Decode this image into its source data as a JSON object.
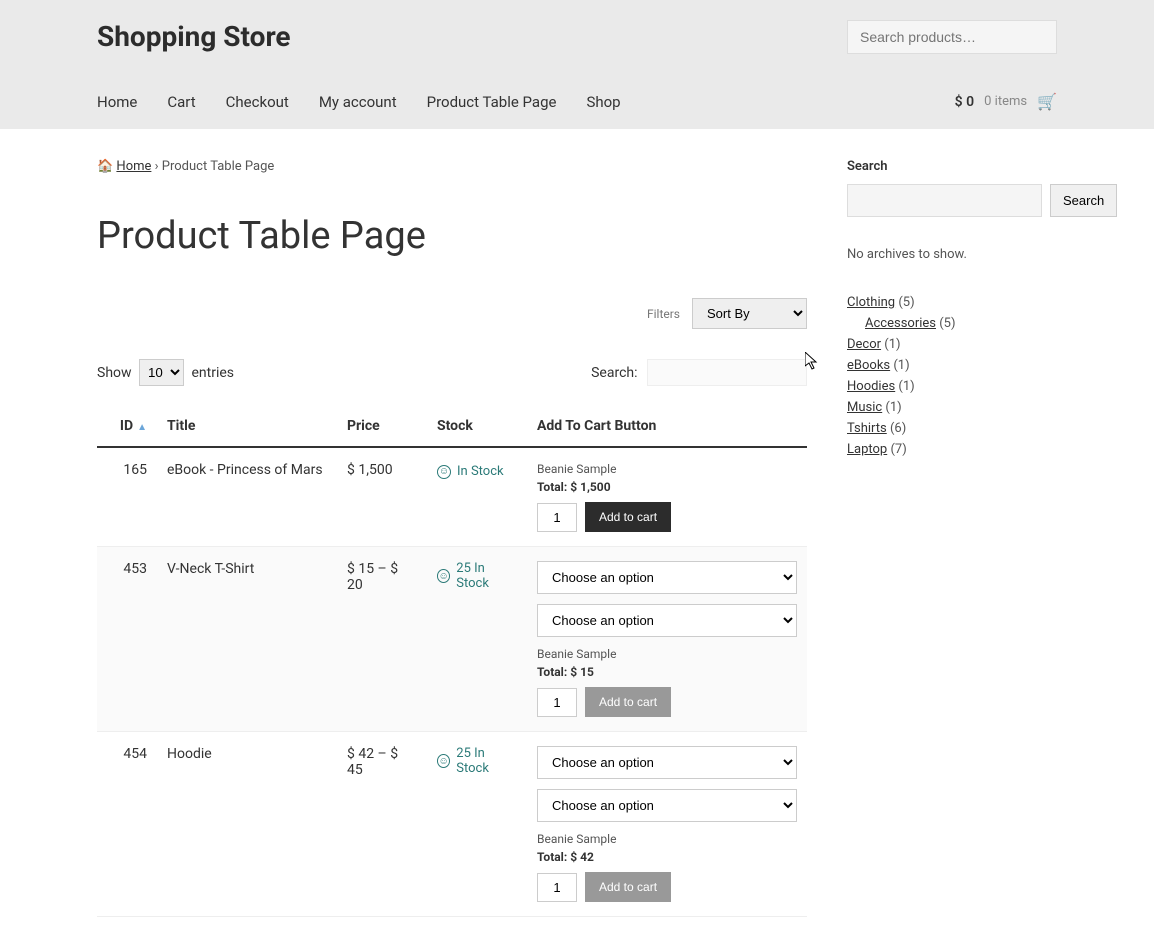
{
  "site_title": "Shopping Store",
  "search_placeholder": "Search products…",
  "nav": [
    "Home",
    "Cart",
    "Checkout",
    "My account",
    "Product Table Page",
    "Shop"
  ],
  "cart": {
    "amount": "$ 0",
    "items": "0 items"
  },
  "breadcrumb": {
    "home": "Home",
    "current": "Product Table Page"
  },
  "page_title": "Product Table Page",
  "filters_label": "Filters",
  "sort_by": "Sort By",
  "show_label_pre": "Show",
  "show_label_post": "entries",
  "show_value": "10",
  "table_search_label": "Search:",
  "columns": {
    "id": "ID",
    "title": "Title",
    "price": "Price",
    "stock": "Stock",
    "add": "Add To Cart Button"
  },
  "rows": [
    {
      "id": "165",
      "title": "eBook - Princess of Mars",
      "price": "$ 1,500",
      "stock": "In Stock",
      "options": [],
      "beanie": "Beanie Sample",
      "total": "Total: $ 1,500",
      "qty": "1",
      "btn": "Add to cart",
      "btn_disabled": false
    },
    {
      "id": "453",
      "title": "V-Neck T-Shirt",
      "price": "$ 15 – $ 20",
      "stock": "25 In Stock",
      "options": [
        "Choose an option",
        "Choose an option"
      ],
      "beanie": "Beanie Sample",
      "total": "Total: $ 15",
      "qty": "1",
      "btn": "Add to cart",
      "btn_disabled": true
    },
    {
      "id": "454",
      "title": "Hoodie",
      "price": "$ 42 – $ 45",
      "stock": "25 In Stock",
      "options": [
        "Choose an option",
        "Choose an option"
      ],
      "beanie": "Beanie Sample",
      "total": "Total: $ 42",
      "qty": "1",
      "btn": "Add to cart",
      "btn_disabled": true
    }
  ],
  "sidebar": {
    "search_label": "Search",
    "search_btn": "Search",
    "no_archives": "No archives to show.",
    "categories": [
      {
        "name": "Clothing",
        "count": "(5)",
        "indent": false
      },
      {
        "name": "Accessories",
        "count": "(5)",
        "indent": true
      },
      {
        "name": "Decor",
        "count": "(1)",
        "indent": false
      },
      {
        "name": "eBooks",
        "count": "(1)",
        "indent": false
      },
      {
        "name": "Hoodies",
        "count": "(1)",
        "indent": false
      },
      {
        "name": "Music",
        "count": "(1)",
        "indent": false
      },
      {
        "name": "Tshirts",
        "count": "(6)",
        "indent": false
      },
      {
        "name": "Laptop",
        "count": "(7)",
        "indent": false
      }
    ]
  }
}
